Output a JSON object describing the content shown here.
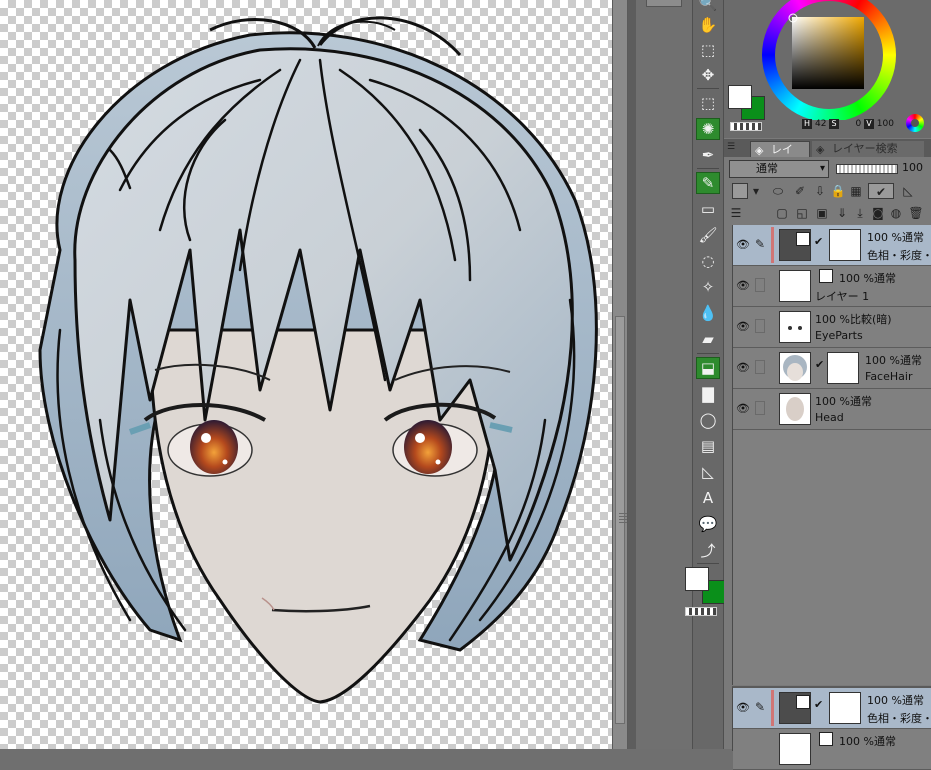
{
  "tool_palette": {
    "tools": [
      {
        "icon": "zoom-icon",
        "glyph": "🔍"
      },
      {
        "icon": "hand-icon",
        "glyph": "✋"
      },
      {
        "icon": "object-icon",
        "glyph": "⬚"
      },
      {
        "icon": "move-icon",
        "glyph": "✥"
      },
      {
        "icon": "selection-icon",
        "glyph": "⬚"
      },
      {
        "icon": "auto-select-icon",
        "glyph": "✺"
      },
      {
        "icon": "eyedropper-icon",
        "glyph": "✒"
      },
      {
        "icon": "pen-icon",
        "glyph": "✎"
      },
      {
        "icon": "eraser-icon",
        "glyph": "▭"
      },
      {
        "icon": "brush-icon",
        "glyph": "🖌"
      },
      {
        "icon": "airbrush-icon",
        "glyph": "◌"
      },
      {
        "icon": "decoration-icon",
        "glyph": "✧"
      },
      {
        "icon": "blend-icon",
        "glyph": "💧"
      },
      {
        "icon": "fill-icon",
        "glyph": "⬓"
      },
      {
        "icon": "gradient-icon",
        "glyph": "▇"
      },
      {
        "icon": "figure-icon",
        "glyph": "◯"
      },
      {
        "icon": "frame-border-icon",
        "glyph": "▤"
      },
      {
        "icon": "ruler-icon",
        "glyph": "◺"
      },
      {
        "icon": "text-icon",
        "glyph": "A"
      },
      {
        "icon": "balloon-icon",
        "glyph": "💬"
      },
      {
        "icon": "correct-line-icon",
        "glyph": "⤴"
      }
    ],
    "main_color": "#ffffff",
    "sub_color": "#0a8f1a"
  },
  "color_wheel": {
    "h_label": "H",
    "h_value": "42",
    "s_label": "S",
    "s_value": "0",
    "v_label": "V",
    "v_value": "100"
  },
  "layer_panel": {
    "tabs": [
      {
        "label": "レイヤー",
        "active": true
      },
      {
        "label": "レイヤー検索",
        "active": false
      }
    ],
    "blend_mode": "通常",
    "opacity": "100",
    "layers": [
      {
        "mode": "100 %通常",
        "name": "色相・彩度・明",
        "selected": true,
        "type": "correction"
      },
      {
        "mode": "100 %通常",
        "name": "レイヤー 1",
        "selected": false,
        "type": "raster"
      },
      {
        "mode": "100 %比較(暗)",
        "name": "EyeParts",
        "selected": false,
        "type": "raster"
      },
      {
        "mode": "100 %通常",
        "name": "FaceHair",
        "selected": false,
        "type": "masked"
      },
      {
        "mode": "100 %通常",
        "name": "Head",
        "selected": false,
        "type": "raster"
      }
    ],
    "bottom_layers": [
      {
        "mode": "100 %通常",
        "name": "色相・彩度・明"
      },
      {
        "mode": "100 %通常",
        "name": ""
      }
    ]
  }
}
